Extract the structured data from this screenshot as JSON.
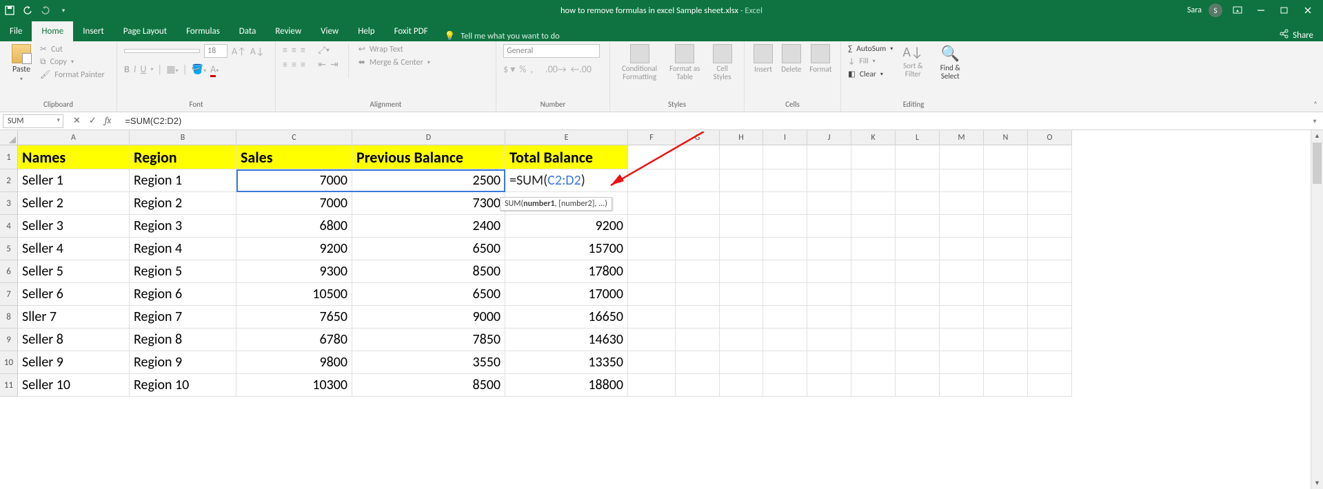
{
  "title": {
    "filename": "how to remove formulas in excel Sample sheet.xlsx",
    "app": "Excel",
    "sep": "  -  "
  },
  "user": {
    "name": "Sara",
    "initial": "S"
  },
  "tabs": [
    "File",
    "Home",
    "Insert",
    "Page Layout",
    "Formulas",
    "Data",
    "Review",
    "View",
    "Help",
    "Foxit PDF"
  ],
  "tellme": "Tell me what you want to do",
  "share": "Share",
  "ribbon": {
    "clipboard": {
      "label": "Clipboard",
      "paste": "Paste",
      "cut": "Cut",
      "copy": "Copy",
      "painter": "Format Painter"
    },
    "font": {
      "label": "Font",
      "size": "18"
    },
    "alignment": {
      "label": "Alignment",
      "wrap": "Wrap Text",
      "merge": "Merge & Center"
    },
    "number": {
      "label": "Number",
      "format": "General"
    },
    "styles": {
      "label": "Styles",
      "cond": "Conditional Formatting",
      "fmtas": "Format as Table",
      "cellst": "Cell Styles"
    },
    "cells": {
      "label": "Cells",
      "insert": "Insert",
      "delete": "Delete",
      "format": "Format"
    },
    "editing": {
      "label": "Editing",
      "autosum": "AutoSum",
      "fill": "Fill",
      "clear": "Clear",
      "sort": "Sort & Filter",
      "find": "Find & Select"
    }
  },
  "namebox": "SUM",
  "formula": "=SUM(C2:D2)",
  "formula_parts": {
    "p1": "=SUM(",
    "p2": "C2:D2",
    "p3": ")"
  },
  "tooltip": {
    "fn": "SUM(",
    "arg1": "number1",
    "rest": ", [number2], ...)"
  },
  "cols": [
    "A",
    "B",
    "C",
    "D",
    "E",
    "F",
    "G",
    "H",
    "I",
    "J",
    "K",
    "L",
    "M",
    "N",
    "O"
  ],
  "headers": {
    "A": "Names",
    "B": "Region",
    "C": "Sales",
    "D": "Previous Balance",
    "E": "Total Balance"
  },
  "rows": [
    {
      "n": "Seller 1",
      "r": "Region 1",
      "s": "7000",
      "p": "2500",
      "t_formula": true
    },
    {
      "n": "Seller 2",
      "r": "Region 2",
      "s": "7000",
      "p": "7300",
      "t": ""
    },
    {
      "n": "Seller 3",
      "r": "Region 3",
      "s": "6800",
      "p": "2400",
      "t": "9200"
    },
    {
      "n": "Seller 4",
      "r": "Region 4",
      "s": "9200",
      "p": "6500",
      "t": "15700"
    },
    {
      "n": "Seller 5",
      "r": "Region 5",
      "s": "9300",
      "p": "8500",
      "t": "17800"
    },
    {
      "n": "Seller 6",
      "r": "Region 6",
      "s": "10500",
      "p": "6500",
      "t": "17000"
    },
    {
      "n": "Sller 7",
      "r": "Region 7",
      "s": "7650",
      "p": "9000",
      "t": "16650"
    },
    {
      "n": "Seller 8",
      "r": "Region 8",
      "s": "6780",
      "p": "7850",
      "t": "14630"
    },
    {
      "n": "Seller 9",
      "r": "Region 9",
      "s": "9800",
      "p": "3550",
      "t": "13350"
    },
    {
      "n": "Seller 10",
      "r": "Region 10",
      "s": "10300",
      "p": "8500",
      "t": "18800"
    }
  ]
}
